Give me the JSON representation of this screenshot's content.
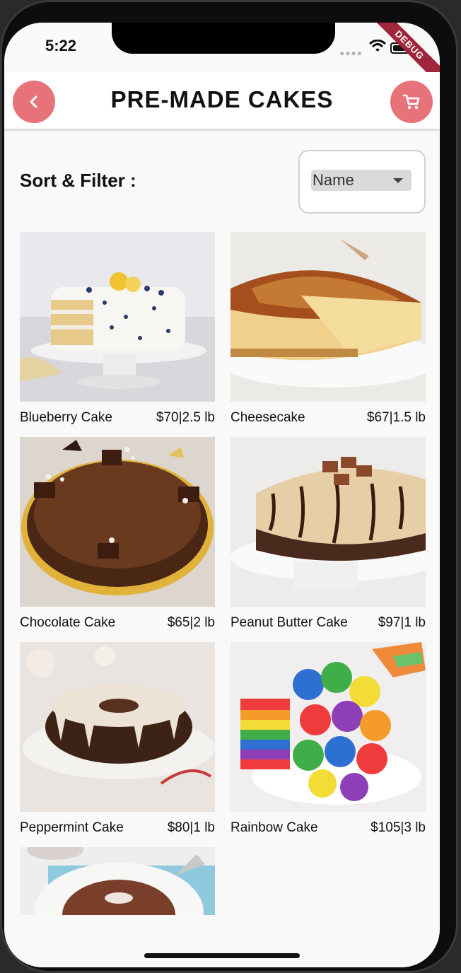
{
  "status": {
    "time": "5:22",
    "debug_label": "DEBUG"
  },
  "header": {
    "title": "PRE-MADE CAKES"
  },
  "sort": {
    "label": "Sort & Filter :",
    "selected": "Name"
  },
  "products": [
    {
      "name": "Blueberry Cake",
      "price": "$70|2.5 lb"
    },
    {
      "name": "Cheesecake",
      "price": "$67|1.5 lb"
    },
    {
      "name": "Chocolate Cake",
      "price": "$65|2 lb"
    },
    {
      "name": "Peanut Butter Cake",
      "price": "$97|1 lb"
    },
    {
      "name": "Peppermint Cake",
      "price": "$80|1 lb"
    },
    {
      "name": "Rainbow Cake",
      "price": "$105|3 lb"
    }
  ],
  "colors": {
    "accent": "#e8727a",
    "debug": "#a0263c"
  }
}
